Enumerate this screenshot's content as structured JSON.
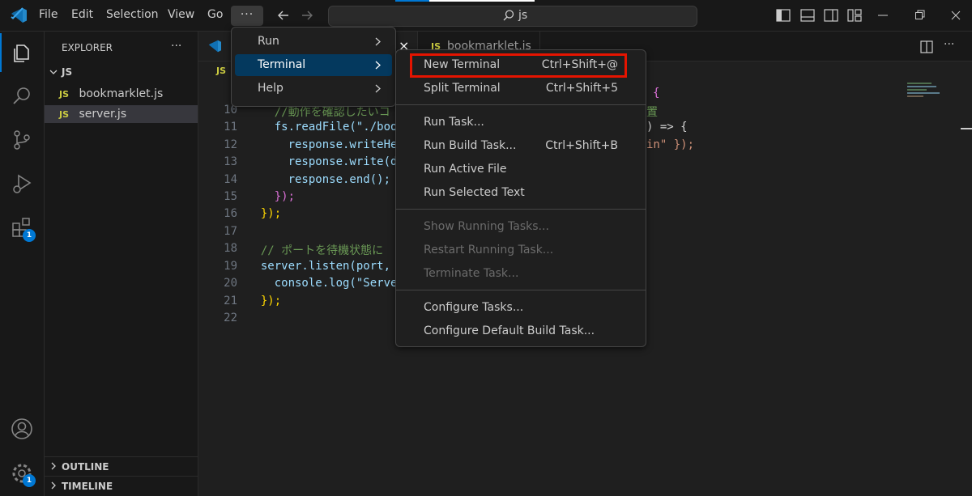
{
  "menubar": {
    "file": "File",
    "edit": "Edit",
    "selection": "Selection",
    "view": "View",
    "go": "Go",
    "more": "···"
  },
  "search": {
    "text": "js"
  },
  "sidebar": {
    "title": "EXPLORER",
    "more": "···",
    "folder": "JS",
    "files": [
      {
        "tag": "JS",
        "name": "bookmarklet.js"
      },
      {
        "tag": "JS",
        "name": "server.js"
      }
    ],
    "outline": "OUTLINE",
    "timeline": "TIMELINE"
  },
  "badges": {
    "extensions": "1",
    "settings": "1"
  },
  "tabs": {
    "second_tab": "bookmarklet.js",
    "breadcrumb_tag": "JS",
    "close_glyph": "×"
  },
  "code": {
    "line_numbers": [
      "10",
      "11",
      "12",
      "13",
      "14",
      "15",
      "16",
      "17",
      "18",
      "19",
      "20",
      "21",
      "22"
    ],
    "lines": [
      "    //動作を確認したいコ",
      "    fs.readFile(\"./boo",
      "      response.writeHe",
      "      response.write(d",
      "      response.end();",
      "    });",
      "  });",
      "",
      "  // ポートを待機状態に",
      "  server.listen(port,",
      "    console.log(\"Serve",
      "  });",
      ""
    ],
    "right_fragments": [
      "{",
      "置",
      ") => {",
      "in\" });"
    ]
  },
  "menu_level1": [
    {
      "label": "Run"
    },
    {
      "label": "Terminal"
    },
    {
      "label": "Help"
    }
  ],
  "menu_terminal": {
    "group1": [
      {
        "label": "New Terminal",
        "shortcut": "Ctrl+Shift+@"
      },
      {
        "label": "Split Terminal",
        "shortcut": "Ctrl+Shift+5"
      }
    ],
    "group2": [
      {
        "label": "Run Task...",
        "shortcut": ""
      },
      {
        "label": "Run Build Task...",
        "shortcut": "Ctrl+Shift+B"
      },
      {
        "label": "Run Active File",
        "shortcut": ""
      },
      {
        "label": "Run Selected Text",
        "shortcut": ""
      }
    ],
    "group3": [
      {
        "label": "Show Running Tasks...",
        "shortcut": ""
      },
      {
        "label": "Restart Running Task...",
        "shortcut": ""
      },
      {
        "label": "Terminate Task...",
        "shortcut": ""
      }
    ],
    "group4": [
      {
        "label": "Configure Tasks...",
        "shortcut": ""
      },
      {
        "label": "Configure Default Build Task...",
        "shortcut": ""
      }
    ]
  },
  "colors": {
    "accent": "#0078d4",
    "highlight_box": "#e51400",
    "selected_menu": "#04395e"
  }
}
